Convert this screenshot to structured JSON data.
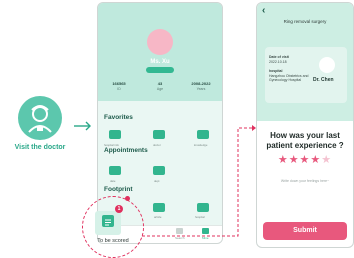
{
  "left": {
    "label": "Visit the doctor",
    "icon": "doctor-icon"
  },
  "phone1": {
    "name": "Ms. Xu",
    "stats": [
      {
        "value": "166565",
        "label": "ID"
      },
      {
        "value": "43",
        "label": "Age"
      },
      {
        "value": "2008-2022",
        "label": "Years"
      }
    ],
    "sections": {
      "favorites": "Favorites",
      "appointments": "Appointments",
      "footprint": "Footprint"
    },
    "favorites_items": [
      "hospital info",
      "doctor",
      "knowledge"
    ],
    "appointments_items": [
      "date",
      "dept"
    ],
    "footprint_items": [
      "scan",
      "article",
      "hospital"
    ],
    "tabs": [
      "Home",
      "Search",
      "Mine"
    ],
    "to_be_scored": "To be scored",
    "badge": "1"
  },
  "phone2": {
    "header": "Ring removal surgery",
    "date_label": "Date of visit",
    "date_value": "2022.10.18",
    "hospital_label": "hospital",
    "hospital_value": "Hangzhou Obstetrics and Gynecology Hospital",
    "doctor": "Dr. Chen",
    "question": "How was your last patient experience ?",
    "stars_filled": 4,
    "stars_total": 5,
    "stars_on": "★★★★",
    "stars_off": "★",
    "hint": "Write down your feelings here~",
    "submit": "Submit"
  },
  "colors": {
    "accent": "#32b58e",
    "pink": "#e8587d",
    "light": "#cdeee3"
  }
}
